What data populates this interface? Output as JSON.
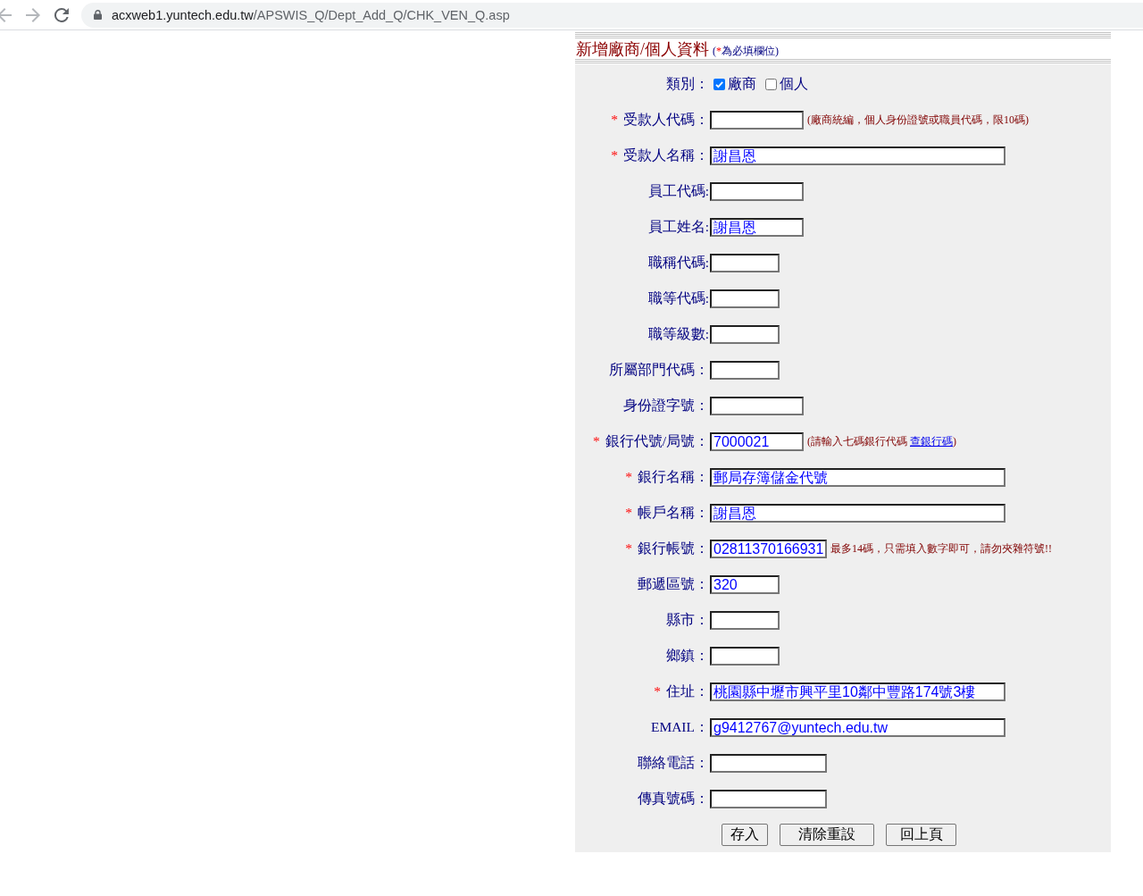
{
  "browser": {
    "nav_buttons": [
      {
        "kind": "back",
        "disabled": true
      },
      {
        "kind": "forward",
        "disabled": true
      },
      {
        "kind": "reload",
        "disabled": false
      }
    ],
    "url": {
      "host": "acxweb1.yuntech.edu.tw",
      "path": "/APSWIS_Q/Dept_Add_Q/CHK_VEN_Q.asp"
    }
  },
  "form": {
    "title": "新增廠商/個人資料",
    "note": {
      "open": "(",
      "mark": "*",
      "text": "為必填欄位)"
    },
    "rows": [
      {
        "kind": "choice",
        "label": "類別：",
        "options": [
          {
            "label": "廠商",
            "checked": true
          },
          {
            "label": "個人",
            "checked": false
          }
        ]
      },
      {
        "kind": "input",
        "required_mark": "*",
        "label": "受款人代碼：",
        "hint": "(廠商統編，個人身份證號或職員代碼，限10碼)"
      },
      {
        "kind": "input",
        "required_mark": "*",
        "label": "受款人名稱：",
        "value": "謝昌恩"
      },
      {
        "kind": "input",
        "label": "員工代碼:"
      },
      {
        "kind": "input",
        "label": "員工姓名:",
        "value": "謝昌恩"
      },
      {
        "kind": "input",
        "label": "職稱代碼:"
      },
      {
        "kind": "input",
        "label": "職等代碼:"
      },
      {
        "kind": "input",
        "label": "職等級數:"
      },
      {
        "kind": "input",
        "label": "所屬部門代碼："
      },
      {
        "kind": "input",
        "label": "身份證字號："
      },
      {
        "kind": "input",
        "required_mark": "*",
        "label": "銀行代號/局號：",
        "value": "7000021",
        "hint": "(請輸入七碼銀行代碼 ",
        "hint_link": "查銀行碼",
        "hint_end": ")"
      },
      {
        "kind": "input",
        "required_mark": "*",
        "label": "銀行名稱：",
        "value": "郵局存簿儲金代號"
      },
      {
        "kind": "input",
        "required_mark": "*",
        "label": "帳戶名稱：",
        "value": "謝昌恩"
      },
      {
        "kind": "input",
        "required_mark": "*",
        "label": "銀行帳號：",
        "value": "02811370166931",
        "hint": "最多14碼，只需填入數字即可，請勿夾雜符號!!"
      },
      {
        "kind": "input",
        "label": "郵遞區號：",
        "value": "320"
      },
      {
        "kind": "input",
        "label": "縣市："
      },
      {
        "kind": "input",
        "label": "鄉鎮："
      },
      {
        "kind": "input",
        "required_mark": "*",
        "label": "住址：",
        "value": "桃園縣中壢市興平里10鄰中豐路174號3樓"
      },
      {
        "kind": "input",
        "label": "EMAIL：",
        "value": "g9412767@yuntech.edu.tw"
      },
      {
        "kind": "input",
        "label": "聯絡電話："
      },
      {
        "kind": "input",
        "label": "傳真號碼："
      }
    ],
    "buttons": [
      {
        "label": "存入"
      },
      {
        "label": "清除重設"
      },
      {
        "label": "回上頁"
      }
    ]
  }
}
